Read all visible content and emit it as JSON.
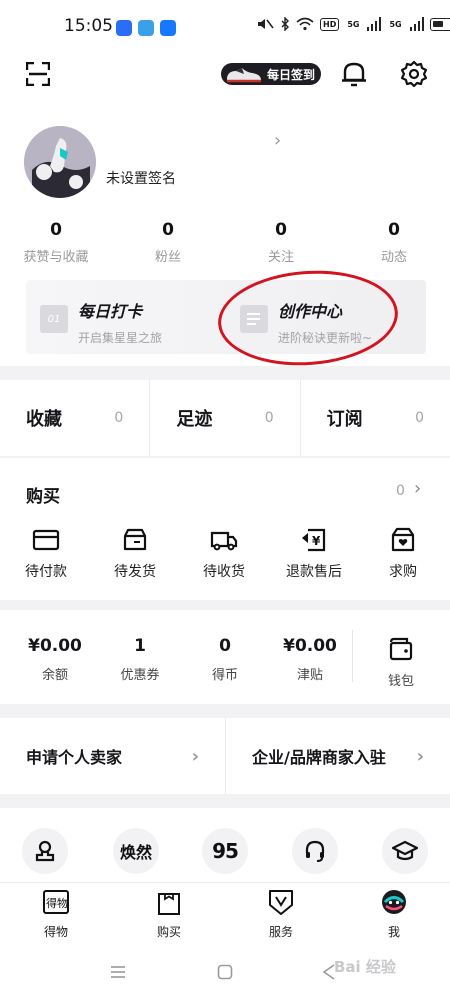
{
  "status_bar": {
    "time": "15:05",
    "badge_hd": "HD",
    "badge_5g_1": "5G",
    "badge_5g_2": "5G"
  },
  "header": {
    "checkin_label": "每日签到",
    "signature": "未设置签名",
    "stats": [
      {
        "value": "0",
        "label": "获赞与收藏"
      },
      {
        "value": "0",
        "label": "粉丝"
      },
      {
        "value": "0",
        "label": "关注"
      },
      {
        "value": "0",
        "label": "动态"
      }
    ]
  },
  "promos": [
    {
      "title": "每日打卡",
      "subtitle": "开启集星星之旅",
      "icon_text": "01",
      "icon": "calendar-icon"
    },
    {
      "title": "创作中心",
      "subtitle": "进阶秘诀更新啦~",
      "icon": "document-icon"
    }
  ],
  "collections": [
    {
      "label": "收藏",
      "count": "0"
    },
    {
      "label": "足迹",
      "count": "0"
    },
    {
      "label": "订阅",
      "count": "0"
    }
  ],
  "buy": {
    "title": "购买",
    "count": "0",
    "items": [
      {
        "label": "待付款",
        "icon": "card-icon"
      },
      {
        "label": "待发货",
        "icon": "box-icon"
      },
      {
        "label": "待收货",
        "icon": "truck-icon"
      },
      {
        "label": "退款售后",
        "icon": "refund-icon"
      },
      {
        "label": "求购",
        "icon": "heart-bag-icon"
      }
    ]
  },
  "wallet": {
    "items": [
      {
        "value": "¥0.00",
        "label": "余额"
      },
      {
        "value": "1",
        "label": "优惠券"
      },
      {
        "value": "0",
        "label": "得币"
      },
      {
        "value": "¥0.00",
        "label": "津贴"
      }
    ],
    "wallet_label": "钱包"
  },
  "seller": {
    "personal": "申请个人卖家",
    "brand": "企业/品牌商家入驻"
  },
  "services": [
    {
      "icon": "stamp-icon",
      "text": ""
    },
    {
      "icon": "huanran-logo",
      "text": "焕然"
    },
    {
      "icon": "95-logo",
      "text": "95"
    },
    {
      "icon": "headset-icon",
      "text": ""
    },
    {
      "icon": "graduation-cap-icon",
      "text": ""
    }
  ],
  "tabs": [
    {
      "label": "得物",
      "icon": "dewu-icon"
    },
    {
      "label": "购买",
      "icon": "shopping-bag-icon"
    },
    {
      "label": "服务",
      "icon": "shield-v-icon"
    },
    {
      "label": "我",
      "icon": "profile-avatar-icon"
    }
  ],
  "watermark": "Bai 经验",
  "colors": {
    "accent_dark": "#1d1d23",
    "annotation_red": "#d3141e",
    "teal": "#19c7c7"
  }
}
